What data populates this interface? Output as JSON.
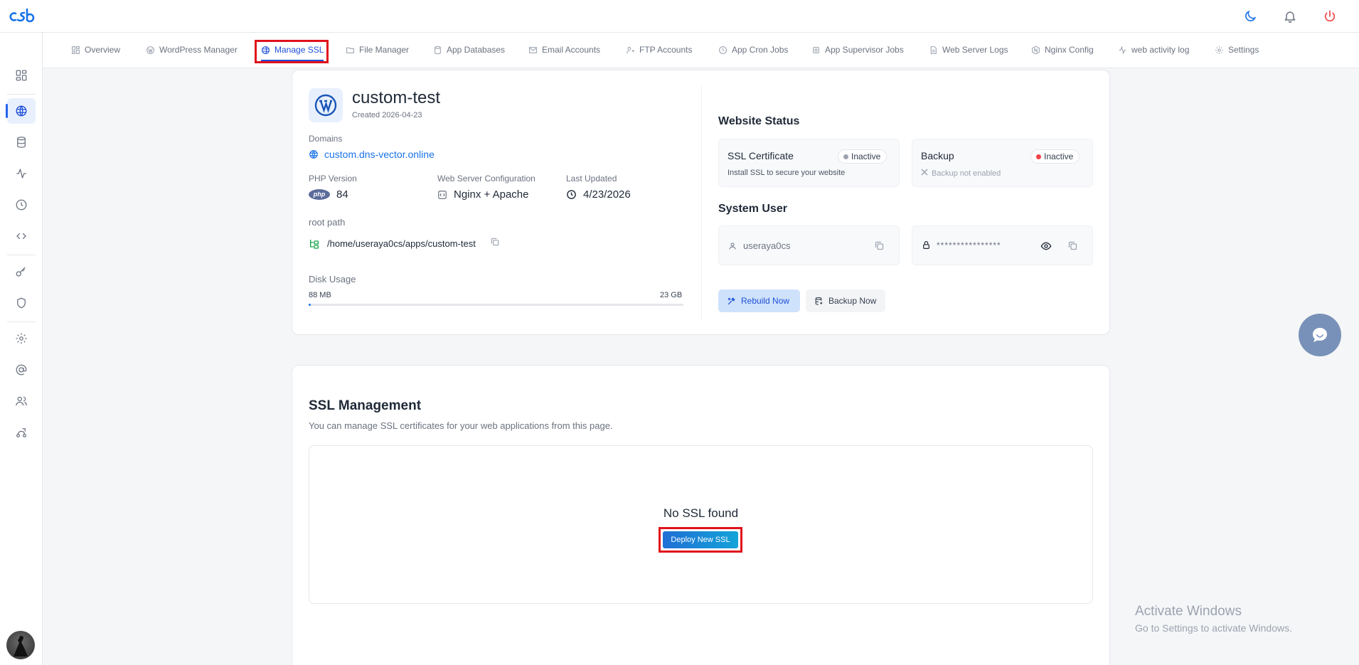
{
  "header": {
    "logo_alt": "cSb",
    "icons": [
      "moon-icon",
      "bell-icon",
      "power-icon"
    ]
  },
  "sidebar": {
    "items": [
      "grid-icon",
      "globe-icon",
      "database-icon",
      "activity-icon",
      "clock-icon",
      "code-icon",
      "key-icon",
      "shield-icon",
      "gear-icon",
      "at-icon",
      "users-icon",
      "route-icon"
    ],
    "active_index": 1
  },
  "tabs": [
    {
      "label": "Overview"
    },
    {
      "label": "WordPress Manager"
    },
    {
      "label": "Manage SSL"
    },
    {
      "label": "File Manager"
    },
    {
      "label": "App Databases"
    },
    {
      "label": "Email Accounts"
    },
    {
      "label": "FTP Accounts"
    },
    {
      "label": "App Cron Jobs"
    },
    {
      "label": "App Supervisor Jobs"
    },
    {
      "label": "Web Server Logs"
    },
    {
      "label": "Nginx Config"
    },
    {
      "label": "web activity log"
    },
    {
      "label": "Settings"
    }
  ],
  "app": {
    "name": "custom-test",
    "created": "Created 2026-04-23",
    "domains_label": "Domains",
    "domain": "custom.dns-vector.online",
    "php_label": "PHP Version",
    "php_badge": "php",
    "php_version": "84",
    "server_label": "Web Server Configuration",
    "server_value": "Nginx + Apache",
    "updated_label": "Last Updated",
    "updated_value": "4/23/2026",
    "root_label": "root path",
    "root_value": "/home/useraya0cs/apps/custom-test",
    "disk_label": "Disk Usage",
    "disk_used": "88 MB",
    "disk_total": "23 GB",
    "disk_fraction": 0.004
  },
  "status": {
    "title": "Website Status",
    "ssl_title": "SSL Certificate",
    "ssl_status": "Inactive",
    "ssl_note": "Install SSL to secure your website",
    "backup_title": "Backup",
    "backup_status": "Inactive",
    "backup_note": "Backup not enabled",
    "system_user_title": "System User",
    "username": "useraya0cs",
    "password_masked": "****************",
    "rebuild_label": "Rebuild Now",
    "backup_label": "Backup Now",
    "colors": {
      "inactive_gray": "#9ca3af",
      "inactive_red": "#ef4444"
    }
  },
  "ssl": {
    "title": "SSL Management",
    "subtitle": "You can manage SSL certificates for your web applications from this page.",
    "empty_text": "No SSL found",
    "deploy_label": "Deploy New SSL"
  },
  "watermark": {
    "line1": "Activate Windows",
    "line2": "Go to Settings to activate Windows."
  },
  "colors": {
    "accent": "#1d4ed8",
    "highlight": "#e0111b",
    "deploy_btn": "#1f7ae0"
  }
}
